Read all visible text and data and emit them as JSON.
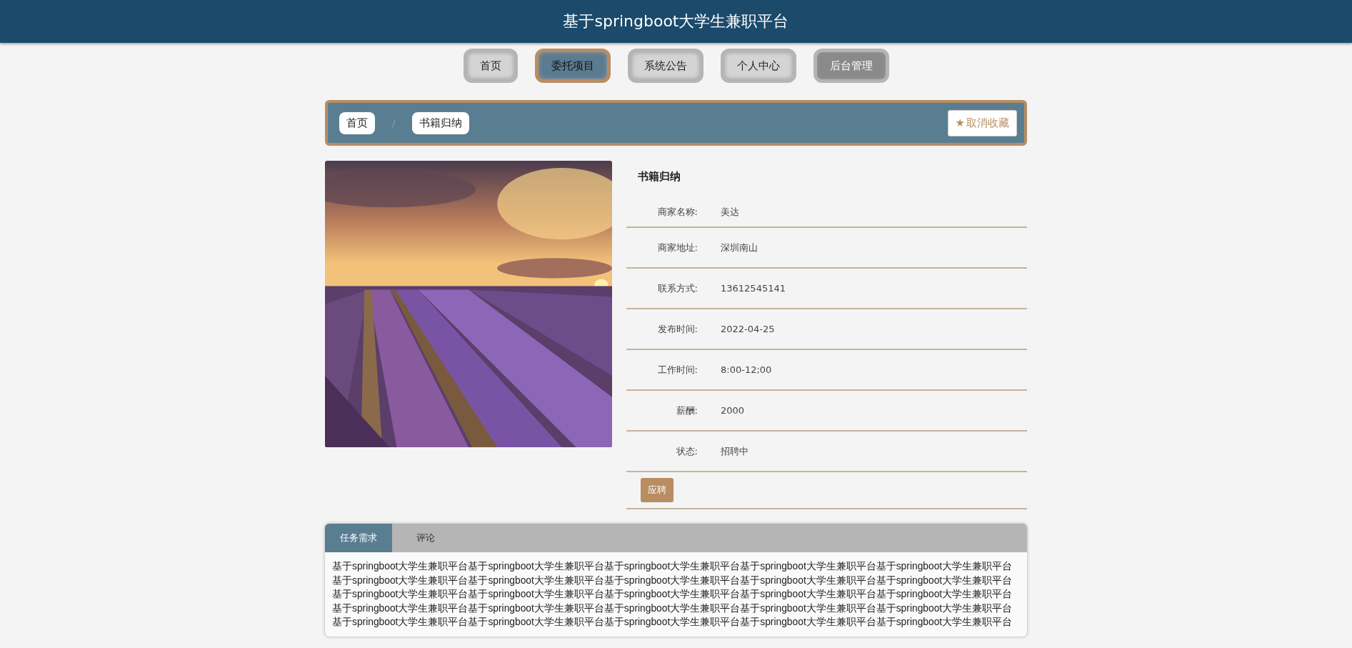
{
  "header": {
    "title": "基于springboot大学生兼职平台"
  },
  "nav": [
    {
      "label": "首页",
      "selected": false,
      "disabled": false
    },
    {
      "label": "委托项目",
      "selected": true,
      "disabled": false
    },
    {
      "label": "系统公告",
      "selected": false,
      "disabled": false
    },
    {
      "label": "个人中心",
      "selected": false,
      "disabled": false
    },
    {
      "label": "后台管理",
      "selected": false,
      "disabled": true
    }
  ],
  "breadcrumb": {
    "items": [
      "首页",
      "书籍归纳"
    ],
    "separator": "/",
    "favorite_button": {
      "icon": "★",
      "label": "取消收藏"
    }
  },
  "detail": {
    "title": "书籍归纳",
    "fields": [
      {
        "label": "商家名称:",
        "value": "美达"
      },
      {
        "label": "商家地址:",
        "value": "深圳南山"
      },
      {
        "label": "联系方式:",
        "value": "13612545141"
      },
      {
        "label": "发布时间:",
        "value": "2022-04-25"
      },
      {
        "label": "工作时间:",
        "value": "8:00-12;00"
      },
      {
        "label": "薪酬:",
        "value": "2000"
      },
      {
        "label": "状态:",
        "value": "招聘中"
      }
    ],
    "apply_button": "应聘"
  },
  "tabs": [
    {
      "label": "任务需求",
      "selected": true
    },
    {
      "label": "评论",
      "selected": false
    }
  ],
  "content": {
    "lines": [
      "基于springboot大学生兼职平台基于springboot大学生兼职平台基于springboot大学生兼职平台基于springboot大学生兼职平台基于springboot大学生兼职平台",
      "基于springboot大学生兼职平台基于springboot大学生兼职平台基于springboot大学生兼职平台基于springboot大学生兼职平台基于springboot大学生兼职平台",
      "基于springboot大学生兼职平台基于springboot大学生兼职平台基于springboot大学生兼职平台基于springboot大学生兼职平台基于springboot大学生兼职平台",
      "基于springboot大学生兼职平台基于springboot大学生兼职平台基于springboot大学生兼职平台基于springboot大学生兼职平台基于springboot大学生兼职平台",
      "基于springboot大学生兼职平台基于springboot大学生兼职平台基于springboot大学生兼职平台基于springboot大学生兼职平台基于springboot大学生兼职平台"
    ]
  }
}
